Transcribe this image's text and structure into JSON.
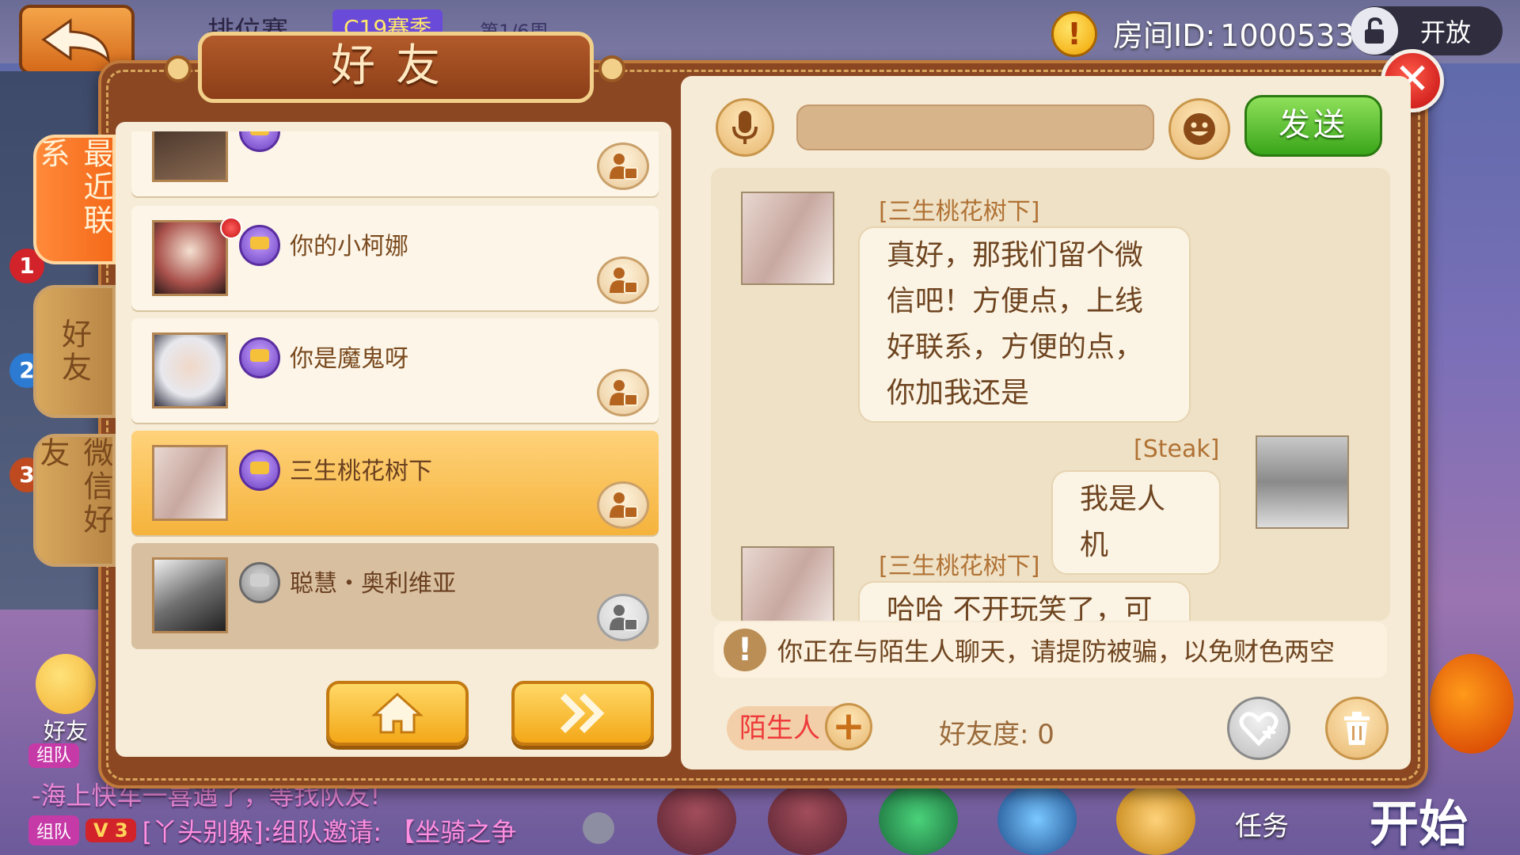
{
  "background": {
    "title": "排位赛",
    "season": "C19赛季",
    "round": "第1/6周",
    "room_id_label": "房间ID:",
    "room_id_value": "1000533",
    "open_label": "开放",
    "friend_hud_label": "好友",
    "chat_lines": [
      {
        "tag": "组队",
        "text": "-海上快车一喜遇了，等找队友!"
      },
      {
        "tag": "组队",
        "vip": "V 3",
        "text": "[丫头别躲]:组队邀请: 【坐骑之争"
      }
    ],
    "task_label": "任务",
    "start_label": "开始",
    "rank_badges": [
      "1",
      "2",
      "3"
    ]
  },
  "dialog": {
    "title": "好友",
    "tabs": [
      {
        "label": "最近联系",
        "active": true
      },
      {
        "label": "好友",
        "active": false
      },
      {
        "label": "微信好友",
        "active": false
      }
    ],
    "friends": [
      {
        "name": "",
        "vip": true,
        "red_dot": false,
        "state": "normal"
      },
      {
        "name": "你的小柯娜",
        "vip": true,
        "red_dot": true,
        "state": "normal"
      },
      {
        "name": "你是魔鬼呀",
        "vip": true,
        "red_dot": false,
        "state": "normal"
      },
      {
        "name": "三生桃花树下",
        "vip": true,
        "red_dot": false,
        "state": "selected"
      },
      {
        "name": "聪慧・奥利维亚",
        "vip": false,
        "red_dot": false,
        "state": "offline"
      }
    ],
    "icons": {
      "home": "home-icon",
      "next": "double-chevron-right-icon",
      "mic": "microphone-icon",
      "emoji": "smiley-icon",
      "heart": "heart-plus-icon",
      "trash": "trash-icon",
      "close": "close-icon",
      "warn": "exclamation-icon"
    }
  },
  "chat": {
    "input_placeholder": "",
    "send_label": "发送",
    "messages": [
      {
        "sender": "[三生桃花树下]",
        "side": "left",
        "lines": [
          "真好，那我们留个微",
          "信吧！方便点，上线",
          "好联系，方便的点，",
          "你加我还是"
        ]
      },
      {
        "sender": "[Steak]",
        "side": "right",
        "lines": [
          "我是人机"
        ]
      },
      {
        "sender": "[三生桃花树下]",
        "side": "left",
        "lines": [
          "哈哈 不开玩笑了，可"
        ]
      }
    ],
    "warning": "你正在与陌生人聊天，请提防被骗，以免财色两空",
    "stranger_label": "陌生人",
    "add_label": "+",
    "intimacy_label": "好友度:",
    "intimacy_value": "0"
  },
  "colors": {
    "dialog_frame": "#8a4722",
    "panel_bg": "#f6ebd6",
    "accent_orange": "#f46a1a",
    "send_green": "#3aa51a",
    "close_red": "#c20e0e"
  }
}
